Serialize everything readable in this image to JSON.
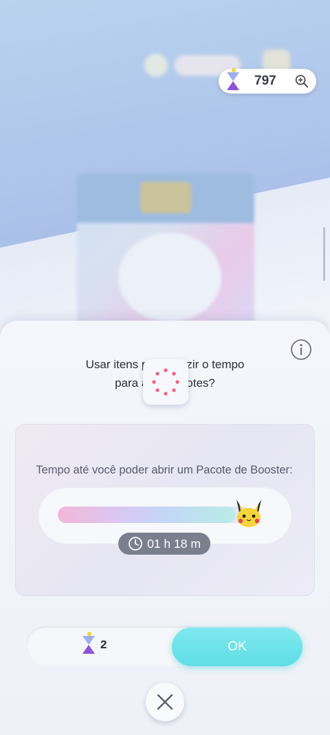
{
  "header": {
    "currency_amount": "797",
    "currency_icon": "hourglass-icon",
    "zoom_icon": "zoom-in-icon"
  },
  "dialog": {
    "question_line1": "Usar itens p",
    "question_line1_end": "zir o tempo",
    "question_line2": "para a",
    "question_line2_end": "otes?",
    "time_label": "Tempo até você poder abrir um Pacote de Booster:",
    "progress": 0.92,
    "timer": "01 h 18 m",
    "cost_amount": "2",
    "ok_label": "OK",
    "close_icon": "close-icon",
    "info_icon": "info-icon"
  },
  "colors": {
    "accent": "#5fdde6",
    "spinner": "#f0607a",
    "timer_badge": "#7a7f8e"
  }
}
